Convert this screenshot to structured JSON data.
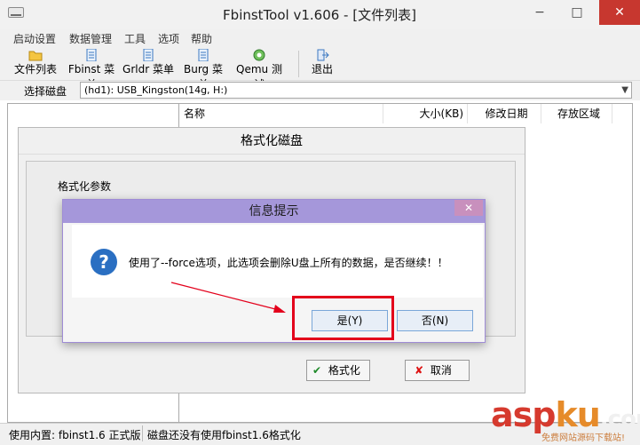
{
  "window": {
    "title": "FbinstTool v1.606 - [文件列表]",
    "minimize": "−",
    "maximize": "□",
    "close": "✕"
  },
  "menu": [
    "启动设置",
    "数据管理",
    "工具",
    "选项",
    "帮助"
  ],
  "toolbar": {
    "file_list": "文件列表",
    "fbinst_menu": "Fbinst 菜单",
    "grldr_menu": "Grldr 菜单",
    "burg_menu": "Burg 菜单",
    "qemu_test": "Qemu 测试",
    "exit": "退出"
  },
  "disk": {
    "label": "选择磁盘",
    "selected": "(hd1): USB_Kingston(14g, H:)"
  },
  "list_columns": {
    "name": "名称",
    "size": "大小(KB)",
    "modified": "修改日期",
    "area": "存放区域"
  },
  "format_dialog": {
    "title": "格式化磁盘",
    "group_label": "格式化参数",
    "format_button": "格式化",
    "cancel_button": "取消",
    "check_glyph": "✔",
    "x_glyph": "✘"
  },
  "message_box": {
    "title": "信息提示",
    "text": "使用了--force选项，此选项会删除U盘上所有的数据，是否继续！！",
    "yes_button": "是(Y)",
    "no_button": "否(N)",
    "icon_glyph": "?"
  },
  "status": {
    "builtin": "使用内置: fbinst1.6 正式版",
    "disk_status": "磁盘还没有使用fbinst1.6格式化"
  },
  "watermark": {
    "brand_a": "asp",
    "brand_b": "ku",
    "brand_c": ".com",
    "sub": "免费网站源码下载站!"
  },
  "colors": {
    "highlight": "#e3001b",
    "msg_title": "#a597da",
    "accent_blue": "#2a6fc2"
  }
}
